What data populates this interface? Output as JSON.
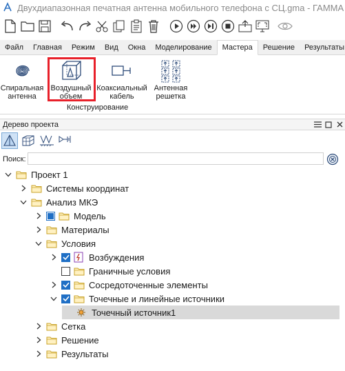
{
  "window": {
    "title": "Двухдиапазонная печатная антенна мобильного телефона с СЦ.gma - ГАММА"
  },
  "toolbar": {
    "icons": [
      "new-file-icon",
      "open-folder-icon",
      "save-icon",
      "undo-icon",
      "redo-icon",
      "cut-icon",
      "copy-icon",
      "paste-icon",
      "delete-icon",
      "run-icon",
      "step-icon",
      "run-all-icon",
      "stop-icon",
      "export-icon",
      "fullscreen-icon",
      "view-icon"
    ]
  },
  "menu": {
    "items": [
      "Файл",
      "Главная",
      "Режим",
      "Вид",
      "Окна",
      "Моделирование",
      "Мастера",
      "Решение",
      "Результаты"
    ],
    "active": "Мастера"
  },
  "ribbon": {
    "tools": [
      {
        "label_line1": "Спиральная",
        "label_line2": "антенна",
        "icon": "spiral-antenna-icon"
      },
      {
        "label_line1": "Воздушный",
        "label_line2": "объем",
        "icon": "air-volume-icon"
      },
      {
        "label_line1": "Коаксиальный",
        "label_line2": "кабель",
        "icon": "coax-cable-icon"
      },
      {
        "label_line1": "Антенная",
        "label_line2": "решетка",
        "icon": "antenna-array-icon"
      }
    ],
    "group_label": "Конструирование",
    "highlight_color": "#e8202a"
  },
  "panel": {
    "title": "Дерево проекта",
    "search_label": "Поиск:",
    "search_value": ""
  },
  "tree": {
    "rows": [
      {
        "label": "Проект 1",
        "level": 0,
        "expand": "open",
        "check": "none",
        "icon": "folder"
      },
      {
        "label": "Системы координат",
        "level": 1,
        "expand": "closed",
        "check": "none",
        "icon": "folder"
      },
      {
        "label": "Анализ МКЭ",
        "level": 1,
        "expand": "open",
        "check": "none",
        "icon": "folder"
      },
      {
        "label": "Модель",
        "level": 2,
        "expand": "closed",
        "check": "partial",
        "icon": "folder"
      },
      {
        "label": "Материалы",
        "level": 2,
        "expand": "closed",
        "check": "none",
        "icon": "folder"
      },
      {
        "label": "Условия",
        "level": 2,
        "expand": "open",
        "check": "none",
        "icon": "folder"
      },
      {
        "label": "Возбуждения",
        "level": 3,
        "expand": "closed",
        "check": "checked",
        "icon": "excitation"
      },
      {
        "label": "Граничные условия",
        "level": 3,
        "expand": "none",
        "check": "unchecked",
        "icon": "folder"
      },
      {
        "label": "Сосредоточенные элементы",
        "level": 3,
        "expand": "closed",
        "check": "checked",
        "icon": "folder"
      },
      {
        "label": "Точечные и линейные источники",
        "level": 3,
        "expand": "open",
        "check": "checked",
        "icon": "folder"
      },
      {
        "label": "Точечный источник1",
        "level": 4,
        "expand": "none",
        "check": "none",
        "icon": "point-source",
        "selected": true
      },
      {
        "label": "Сетка",
        "level": 2,
        "expand": "closed",
        "check": "none",
        "icon": "folder"
      },
      {
        "label": "Решение",
        "level": 2,
        "expand": "closed",
        "check": "none",
        "icon": "folder"
      },
      {
        "label": "Результаты",
        "level": 2,
        "expand": "closed",
        "check": "none",
        "icon": "folder"
      }
    ]
  },
  "colors": {
    "checkbox": "#1f6fc5",
    "folder_fill": "#fff1c2",
    "folder_stroke": "#c9a227",
    "selected_row": "#d9d9d9"
  }
}
